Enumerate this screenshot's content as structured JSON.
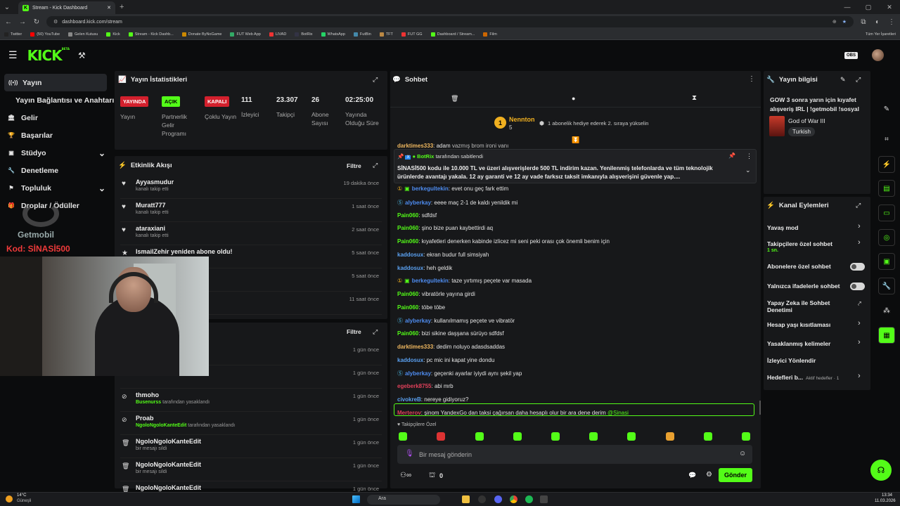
{
  "browser": {
    "tab_title": "Stream - Kick Dashboard",
    "url": "dashboard.kick.com/stream",
    "bookmarks": [
      "Twitter",
      "(50) YouTube",
      "Gelen Kutusu",
      "Kick",
      "Stream - Kick Dashb...",
      "Donate ByNoGame",
      "FUT Web App",
      "LIVAD",
      "BotRix",
      "WhatsApp",
      "FutBin",
      "TFT",
      "FUT GG",
      "Dashboard / Stream...",
      "Film"
    ],
    "bookmarks_right": "Tüm Yer İşaretleri"
  },
  "header": {
    "logo": "KICK",
    "beta": "BETA"
  },
  "sidebar": {
    "items": [
      {
        "label": "Yayın",
        "icon": "broadcast-icon"
      },
      {
        "label": "Yayın Bağlantısı ve Anahtarı",
        "icon": ""
      },
      {
        "label": "Gelir",
        "icon": "bank-icon"
      },
      {
        "label": "Başarılar",
        "icon": "trophy-icon"
      },
      {
        "label": "Stüdyo",
        "icon": "studio-icon"
      },
      {
        "label": "Denetleme",
        "icon": "wrench-icon"
      },
      {
        "label": "Topluluk",
        "icon": "community-icon"
      },
      {
        "label": "Droplar / Ödüller",
        "icon": "gift-icon"
      }
    ]
  },
  "overlay": {
    "brand": "Getmobil",
    "code": "Kod: SİNASİ500"
  },
  "stats": {
    "title": "Yayın İstatistikleri",
    "badges": [
      {
        "text": "YAYINDA",
        "label": "Yayın"
      },
      {
        "text": "AÇIK",
        "label": "Partnerlik Gelir Programı"
      },
      {
        "text": "KAPALI",
        "label": "Çoklu Yayın"
      }
    ],
    "numbers": [
      {
        "value": "111",
        "label": "İzleyici"
      },
      {
        "value": "23.307",
        "label": "Takipçi"
      },
      {
        "value": "26",
        "label": "Abone Sayısı"
      },
      {
        "value": "02:25:00",
        "label": "Yayında Olduğu Süre"
      }
    ]
  },
  "activity": {
    "title": "Etkinlik Akışı",
    "filter": "Filtre",
    "items": [
      {
        "name": "Ayyasmudur",
        "sub": "kanalı takip etti",
        "time": "19 dakika önce"
      },
      {
        "name": "Muratt777",
        "sub": "kanalı takip etti",
        "time": "1 saat önce"
      },
      {
        "name": "ataraxiani",
        "sub": "kanalı takip etti",
        "time": "2 saat önce"
      },
      {
        "name": "IsmailZehir yeniden abone oldu!",
        "sub": "",
        "time": "5 saat önce"
      },
      {
        "name": "oldu!",
        "sub": "",
        "time": "5 saat önce"
      },
      {
        "name": "",
        "sub": "",
        "time": "11 saat önce"
      }
    ]
  },
  "modlog": {
    "filter": "Filtre",
    "items": [
      {
        "name": "",
        "sub": "lı",
        "time": "1 gün önce"
      },
      {
        "name": "",
        "sub": "",
        "time": "1 gün önce"
      },
      {
        "name": "thmoho",
        "sub": "Busenurss",
        "sub2": "tarafından yasaklandı",
        "time": "1 gün önce"
      },
      {
        "name": "Proab",
        "sub": "NgoloNgoloKanteEdit",
        "sub2": "tarafından yasaklandı",
        "time": "1 gün önce"
      },
      {
        "name": "NgoloNgoloKanteEdit",
        "sub": "bir mesajı sildi",
        "time": "1 gün önce"
      },
      {
        "name": "NgoloNgoloKanteEdit",
        "sub": "bir mesajı sildi",
        "time": "1 gün önce"
      },
      {
        "name": "NgoloNgoloKanteEdit",
        "sub": "bir mesajı sildi",
        "time": "1 gün önce"
      }
    ]
  },
  "chat": {
    "title": "Sohbet",
    "gifter": {
      "name": "Nennton",
      "count": "5",
      "rank": "1",
      "text": "1 abonelik hediye ederek 2. sıraya yükselin"
    },
    "pinned": {
      "by": "BotRix",
      "by_suffix": "tarafından sabitlendi",
      "text": "SİNASİ500 kodu ile 10.000 TL ve üzeri alışverişlerde 500 TL indirim kazan.  Yenilenmiş telefonlarda ve tüm teknolojik ürünlerde avantajı yakala. 12 ay garanti ve 12 ay vade farksız taksit imkanıyla alışverişini güvenle yap...."
    },
    "messages": [
      {
        "user": "berkegultekin",
        "text": "evet onu geç fark ettim",
        "color": "#4e8cf0"
      },
      {
        "user": "alyberkay",
        "text": "eeee maç 2-1 de kaldı yenildik mi",
        "color": "#4e8cf0"
      },
      {
        "user": "Pain060",
        "text": "sdfdsf",
        "color": "#53fc18"
      },
      {
        "user": "Pain060",
        "text": "şino bize puan kaybettirdi aq",
        "color": "#53fc18"
      },
      {
        "user": "Pain060",
        "text": "kıyafetleri denerken kabinde izlicez mi seni peki orası çok önemli benim için",
        "color": "#53fc18"
      },
      {
        "user": "kaddosux",
        "text": "ekran budur full simsiyah",
        "color": "#5aa0f0"
      },
      {
        "user": "kaddosux",
        "text": "heh geldik",
        "color": "#5aa0f0"
      },
      {
        "user": "berkegultekin",
        "text": "taze yırtımış peçete var masada",
        "color": "#4e8cf0"
      },
      {
        "user": "Pain060",
        "text": "vibratörle yayına girdi",
        "color": "#53fc18"
      },
      {
        "user": "Pain060",
        "text": "töbe töbe",
        "color": "#53fc18"
      },
      {
        "user": "alyberkay",
        "text": "kullanılmamış peçete ve vibratör",
        "color": "#4e8cf0"
      },
      {
        "user": "Pain060",
        "text": "bizi sikine daşşana sürüyo sdfdsf",
        "color": "#53fc18"
      },
      {
        "user": "darktimes333",
        "text": "dedim noluyo adasdsaddas",
        "color": "#f0b860"
      },
      {
        "user": "kaddosux",
        "text": "pc mic ini kapat yine dondu",
        "color": "#5aa0f0"
      },
      {
        "user": "alyberkay",
        "text": "geçenki ayarlar iyiydi aynı şekil yap",
        "color": "#4e8cf0"
      },
      {
        "user": "egeberk8755",
        "text": "abi mrb",
        "color": "#e0405a"
      },
      {
        "user": "civokreB",
        "text": "nereye gidiyoruz?",
        "color": "#5aa0f0"
      },
      {
        "user": "Merterov",
        "text": "şinom YandexGo dan taksi çağırsan daha hesaplı olur bir ara dene derim ",
        "mention": "@Sinasi",
        "color": "#e0405a"
      }
    ],
    "followers_only": "Takipçilere Özel",
    "input_placeholder": "Bir mesaj gönderin",
    "points": "0",
    "send": "Gönder",
    "top_user": "darktimes333",
    "top_text": "adam",
    "top_text2": "vazmış brom ironi vanı"
  },
  "info": {
    "title": "Yayın bilgisi",
    "stream_title": "GOW 3 sonra yarın için kıyafet alışveriş IRL | !getmobil !sosyal",
    "game": "God of War III",
    "language": "Turkish"
  },
  "actions": {
    "title": "Kanal Eylemleri",
    "items": [
      {
        "label": "Yavaş mod",
        "type": "arrow"
      },
      {
        "label": "Takipçilere özel sohbet",
        "sub": "1 sn.",
        "type": "arrow"
      },
      {
        "label": "Abonelere özel sohbet",
        "type": "toggle"
      },
      {
        "label": "Yalnızca ifadelerle sohbet",
        "type": "toggle"
      },
      {
        "label": "Yapay Zeka ile Sohbet Denetimi",
        "type": "ext"
      },
      {
        "label": "Hesap yaşı kısıtlaması",
        "type": "arrow"
      },
      {
        "label": "Yasaklanmış kelimeler",
        "type": "arrow"
      },
      {
        "label": "İzleyici Yönlendir",
        "type": "none"
      },
      {
        "label": "Hedefleri b...",
        "sub": "Aktif hedefler · 1",
        "type": "arrow"
      }
    ]
  },
  "taskbar": {
    "weather_temp": "14°C",
    "weather_text": "Güneşli",
    "search": "Ara",
    "time": "13:34",
    "date": "11.03.2026"
  },
  "colors": {
    "kick_green": "#53fc18",
    "live_red": "#d3202d"
  }
}
